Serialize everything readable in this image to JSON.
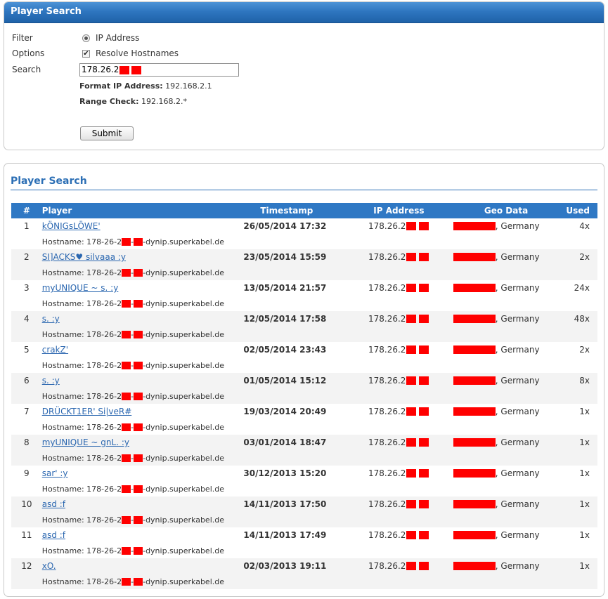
{
  "search_panel": {
    "title": "Player Search",
    "filter_label": "Filter",
    "filter_value": "IP Address",
    "options_label": "Options",
    "options_value": "Resolve Hostnames",
    "search_label": "Search",
    "search_value": "178.26.2",
    "hint_format_label": "Format IP Address:",
    "hint_format_value": "192.168.2.1",
    "hint_range_label": "Range Check:",
    "hint_range_value": "192.168.2.*",
    "submit_label": "Submit"
  },
  "results_panel": {
    "title": "Player Search",
    "columns": [
      "#",
      "Player",
      "Timestamp",
      "IP Address",
      "Geo Data",
      "Used"
    ],
    "hostname_label": "Hostname:",
    "hostname_prefix": "178-26-2",
    "hostname_suffix": "-dynip.superkabel.de",
    "ip_prefix": "178.26.2",
    "geo_suffix": ", Germany",
    "rows": [
      {
        "num": "1",
        "player": "kÖNIGsLÖWE'",
        "timestamp": "26/05/2014 17:32",
        "used": "4x"
      },
      {
        "num": "2",
        "player": "SI]ACKS♥ silvaaa :y",
        "timestamp": "23/05/2014 15:59",
        "used": "2x"
      },
      {
        "num": "3",
        "player": "myUNIQUE ~ s. :y",
        "timestamp": "13/05/2014 21:57",
        "used": "24x"
      },
      {
        "num": "4",
        "player": "s. :y",
        "timestamp": "12/05/2014 17:58",
        "used": "48x"
      },
      {
        "num": "5",
        "player": "crakZ'",
        "timestamp": "02/05/2014 23:43",
        "used": "2x"
      },
      {
        "num": "6",
        "player": "s. :y",
        "timestamp": "01/05/2014 15:12",
        "used": "8x"
      },
      {
        "num": "7",
        "player": "DRÜCKT1ER' Si|veR#",
        "timestamp": "19/03/2014 20:49",
        "used": "1x"
      },
      {
        "num": "8",
        "player": "myUNIQUE ~ gnL. :y",
        "timestamp": "03/01/2014 18:47",
        "used": "1x"
      },
      {
        "num": "9",
        "player": "sar' :y",
        "timestamp": "30/12/2013 15:20",
        "used": "1x"
      },
      {
        "num": "10",
        "player": "asd :f",
        "timestamp": "14/11/2013 17:50",
        "used": "1x"
      },
      {
        "num": "11",
        "player": "asd :f",
        "timestamp": "14/11/2013 17:49",
        "used": "1x"
      },
      {
        "num": "12",
        "player": "xO.",
        "timestamp": "02/03/2013 19:11",
        "used": "1x"
      }
    ]
  },
  "colors": {
    "header_blue": "#2f78c4",
    "title_blue": "#2c6fb5",
    "redaction": "#ff0000",
    "link": "#2b67b0"
  }
}
